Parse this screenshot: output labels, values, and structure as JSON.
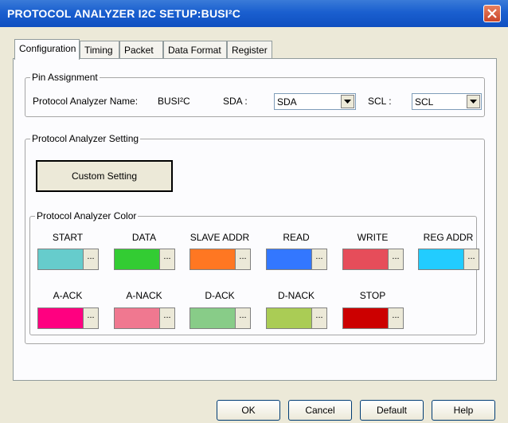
{
  "window": {
    "title": "PROTOCOL ANALYZER I2C SETUP:BUSI²C"
  },
  "tabs": [
    {
      "label": "Configuration"
    },
    {
      "label": "Timing"
    },
    {
      "label": "Packet"
    },
    {
      "label": "Data Format"
    },
    {
      "label": "Register"
    }
  ],
  "pin_assignment": {
    "legend": "Pin Assignment",
    "name_label": "Protocol Analyzer Name:",
    "name_value": "BUSI²C",
    "sda_label": "SDA :",
    "sda_value": "SDA",
    "scl_label": "SCL :",
    "scl_value": "SCL"
  },
  "setting": {
    "legend": "Protocol Analyzer Setting",
    "custom_button": "Custom Setting"
  },
  "colors": {
    "legend": "Protocol Analyzer Color",
    "items": [
      {
        "label": "START",
        "color": "#66cccc"
      },
      {
        "label": "DATA",
        "color": "#33cc33"
      },
      {
        "label": "SLAVE ADDR",
        "color": "#ff7722"
      },
      {
        "label": "READ",
        "color": "#3377ff"
      },
      {
        "label": "WRITE",
        "color": "#e64d5a"
      },
      {
        "label": "REG ADDR",
        "color": "#22ccff"
      },
      {
        "label": "A-ACK",
        "color": "#ff0080"
      },
      {
        "label": "A-NACK",
        "color": "#f07890"
      },
      {
        "label": "D-ACK",
        "color": "#88cc88"
      },
      {
        "label": "D-NACK",
        "color": "#aacc55"
      },
      {
        "label": "STOP",
        "color": "#cc0000"
      }
    ],
    "dots": "..."
  },
  "buttons": {
    "ok": "OK",
    "cancel": "Cancel",
    "default": "Default",
    "help": "Help"
  }
}
